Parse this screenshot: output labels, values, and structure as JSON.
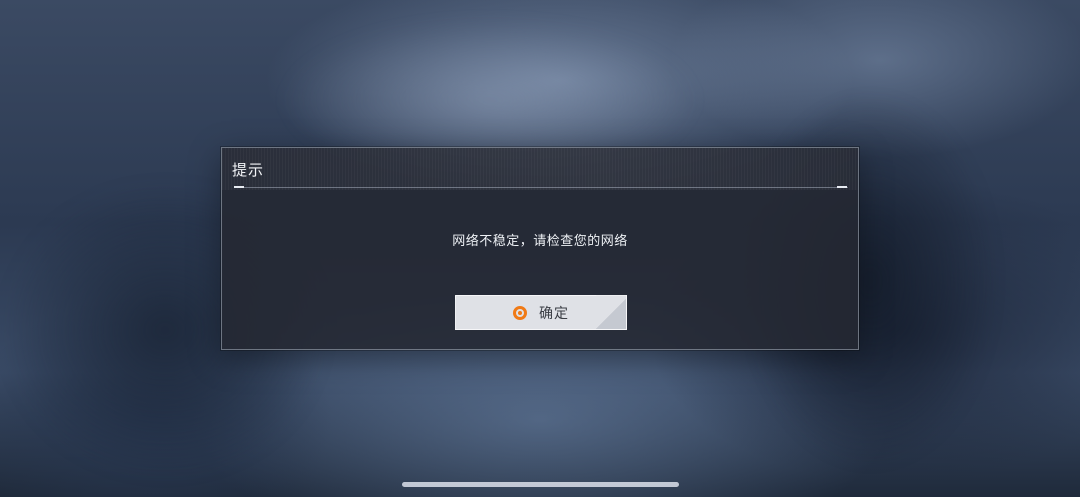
{
  "dialog": {
    "title": "提示",
    "message": "网络不稳定，请检查您的网络",
    "confirm_label": "确定",
    "confirm_icon": "circle-target-icon"
  },
  "colors": {
    "accent": "#f07a16",
    "button_bg": "#dfe1e6",
    "dialog_bg": "#242832"
  }
}
